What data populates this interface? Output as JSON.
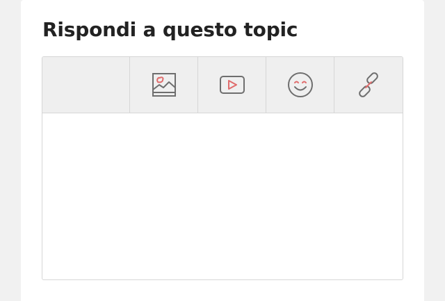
{
  "reply_card": {
    "title": "Rispondi a questo topic"
  },
  "toolbar": {
    "buttons": [
      {
        "icon": "image-icon"
      },
      {
        "icon": "video-icon"
      },
      {
        "icon": "emoji-icon"
      },
      {
        "icon": "link-icon"
      }
    ]
  },
  "reply_box": {
    "value": "",
    "placeholder": ""
  },
  "colors": {
    "icon_gray": "#6e6e6e",
    "icon_accent": "#e06c6c",
    "toolbar_bg": "#efefef",
    "border": "#d6d6d6"
  }
}
